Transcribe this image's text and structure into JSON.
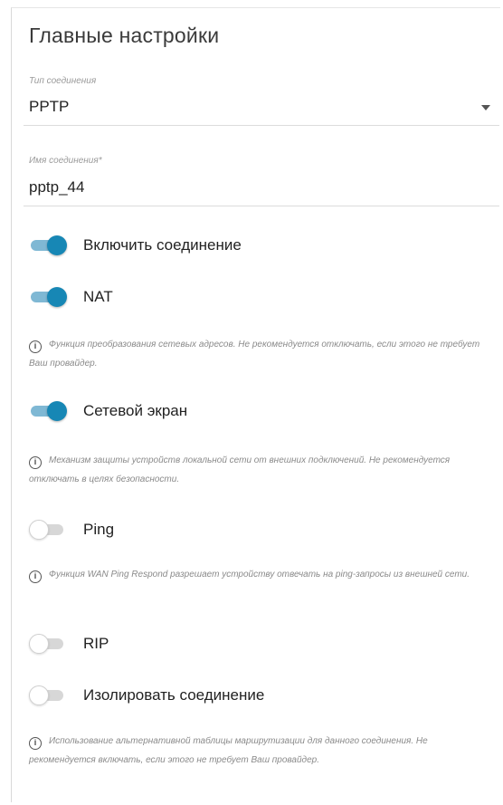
{
  "section": {
    "title": "Главные настройки"
  },
  "connection_type": {
    "label": "Тип соединения",
    "value": "PPTP"
  },
  "connection_name": {
    "label": "Имя соединения*",
    "value": "pptp_44"
  },
  "toggles": {
    "enable_connection": {
      "label": "Включить соединение",
      "state": "on"
    },
    "nat": {
      "label": "NAT",
      "state": "on"
    },
    "firewall": {
      "label": "Сетевой экран",
      "state": "on"
    },
    "ping": {
      "label": "Ping",
      "state": "off"
    },
    "rip": {
      "label": "RIP",
      "state": "off"
    },
    "isolate": {
      "label": "Изолировать соединение",
      "state": "off"
    }
  },
  "notes": {
    "nat": "Функция преобразования сетевых адресов. Не рекомендуется отключать, если этого не требует Ваш провайдер.",
    "firewall": "Механизм защиты устройств локальной сети от внешних подключений. Не рекомендуется отключать в целях безопасности.",
    "ping": "Функция WAN Ping Respond разрешает устройству отвечать на ping-запросы из внешней сети.",
    "isolate": "Использование альтернативной таблицы маршрутизации для данного соединения. Не рекомендуется включать, если этого не требует Ваш провайдер."
  },
  "icons": {
    "info_glyph": "i"
  },
  "colors": {
    "toggle_on": "#1787b5",
    "toggle_on_track": "#7fb8d4",
    "toggle_off_track": "#d7d7d7"
  }
}
